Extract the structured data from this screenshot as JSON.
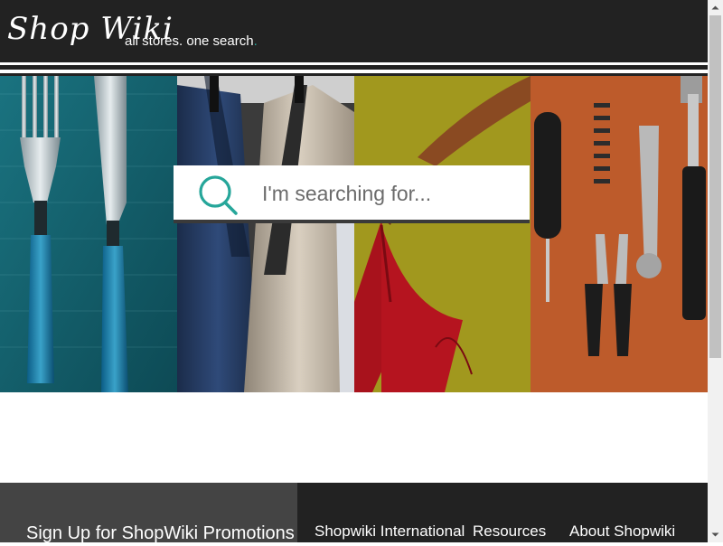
{
  "header": {
    "logo_text": "Shop Wiki",
    "tagline": "all stores. one search",
    "tagline_dot": "."
  },
  "search": {
    "placeholder": "I'm searching for...",
    "value": ""
  },
  "footer": {
    "signup_text": "Sign Up for ShopWiki Promotions",
    "links": [
      {
        "label": "Shopwiki International"
      },
      {
        "label": "Resources"
      },
      {
        "label": "About Shopwiki"
      }
    ]
  },
  "hero_panels": [
    {
      "icon": "cutlery-photo"
    },
    {
      "icon": "jackets-photo"
    },
    {
      "icon": "dress-hanger-photo"
    },
    {
      "icon": "tools-photo"
    }
  ],
  "colors": {
    "accent": "#26a69a",
    "header_bg": "#222222",
    "footer_left_bg": "#444444",
    "footer_right_bg": "#222222"
  }
}
